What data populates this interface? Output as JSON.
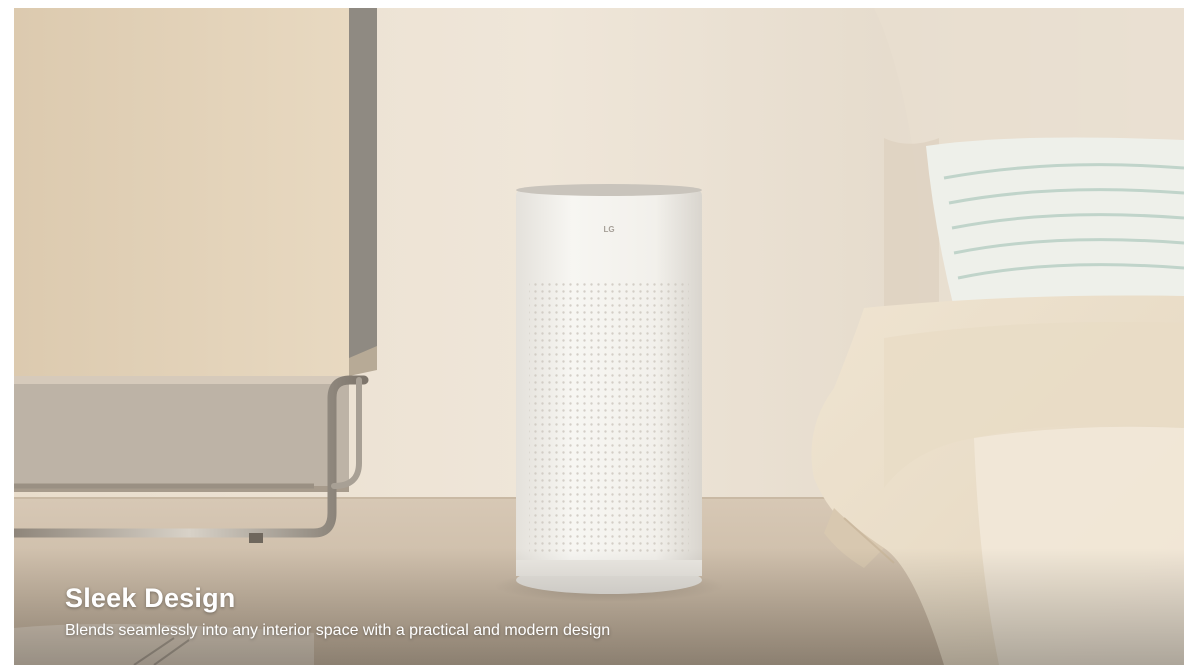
{
  "caption": {
    "title": "Sleek Design",
    "subtitle": "Blends seamlessly into any interior space with a practical and modern design"
  },
  "product": {
    "logo_text": "LG"
  },
  "colors": {
    "wall": "#ece2d4",
    "floor": "#cdbda9",
    "cabinet": "#e3d2b6",
    "purifier": "#f3f1ec",
    "bedding": "#f1e7d5",
    "caption_text": "#ffffff"
  },
  "icons": [
    "lg-logo-icon"
  ]
}
